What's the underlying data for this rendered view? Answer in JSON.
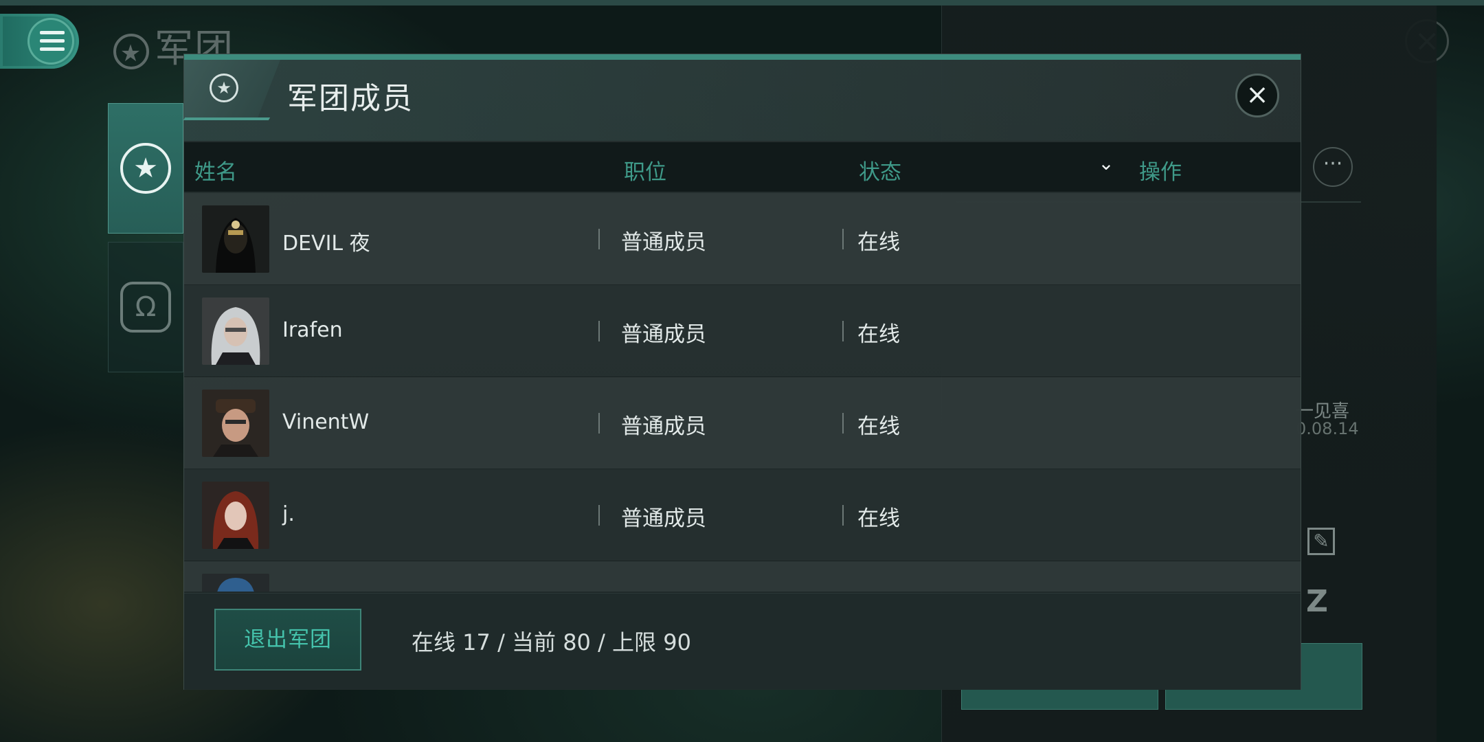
{
  "header": {
    "title": "军团",
    "menu_icon": "hamburger-menu-icon",
    "close_icon": "close-icon"
  },
  "side_nav": [
    {
      "icon": "legion-member-star-icon",
      "active": true
    },
    {
      "icon": "omega-member-icon",
      "active": false
    }
  ],
  "right_panel": {
    "more_label": "···",
    "peek_name": "一见喜",
    "peek_date": "0.08.14"
  },
  "modal": {
    "title": "军团成员",
    "columns": {
      "name": "姓名",
      "role": "职位",
      "status": "状态",
      "action": "操作"
    },
    "sort_icon": "chevron-down-icon",
    "members": [
      {
        "name": "DEVIL 夜",
        "role": "普通成员",
        "status": "在线"
      },
      {
        "name": "Irafen",
        "role": "普通成员",
        "status": "在线"
      },
      {
        "name": "VinentW",
        "role": "普通成员",
        "status": "在线"
      },
      {
        "name": "j.",
        "role": "普通成员",
        "status": "在线"
      },
      {
        "name": "",
        "role": "",
        "status": ""
      }
    ],
    "leave_button": "退出军团",
    "stats": "在线 17 / 当前 80 / 上限 90"
  },
  "colors": {
    "accent": "#3f9a89",
    "button_text": "#45c3ac",
    "bar": "#3d8c7e"
  }
}
